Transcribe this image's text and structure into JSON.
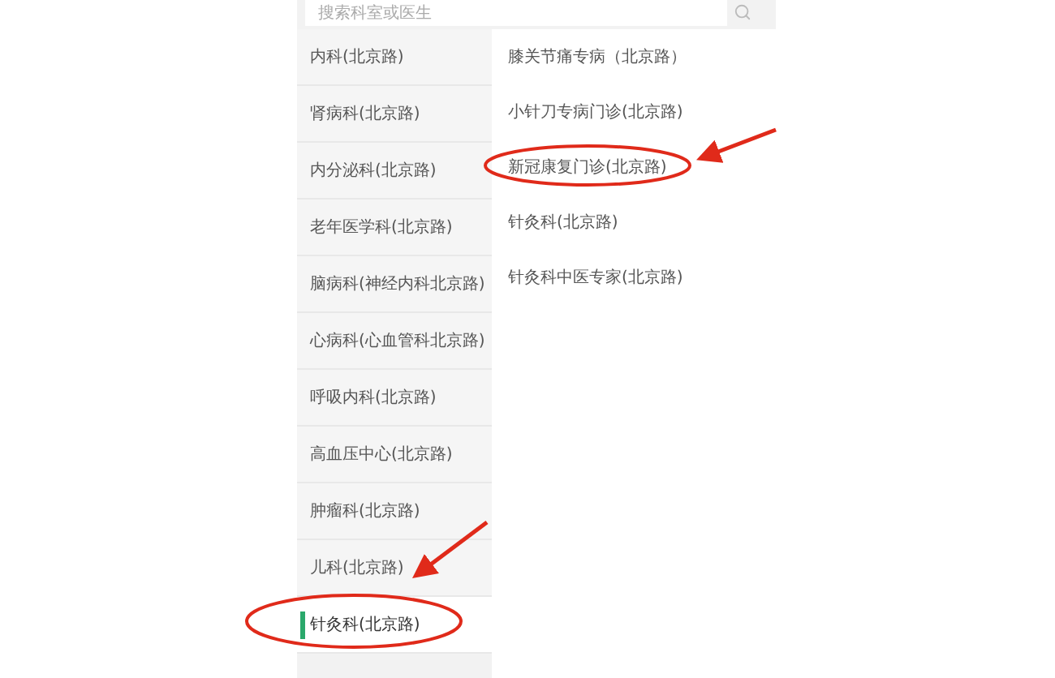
{
  "search": {
    "placeholder": "搜索科室或医生"
  },
  "departments": [
    {
      "label": "内科(北京路)",
      "selected": false
    },
    {
      "label": "肾病科(北京路)",
      "selected": false
    },
    {
      "label": "内分泌科(北京路)",
      "selected": false
    },
    {
      "label": "老年医学科(北京路)",
      "selected": false
    },
    {
      "label": "脑病科(神经内科北京路)",
      "selected": false
    },
    {
      "label": "心病科(心血管科北京路)",
      "selected": false
    },
    {
      "label": "呼吸内科(北京路)",
      "selected": false
    },
    {
      "label": "高血压中心(北京路)",
      "selected": false
    },
    {
      "label": "肿瘤科(北京路)",
      "selected": false
    },
    {
      "label": "儿科(北京路)",
      "selected": false
    },
    {
      "label": "针灸科(北京路)",
      "selected": true
    }
  ],
  "clinics": [
    {
      "label": "膝关节痛专病（北京路）"
    },
    {
      "label": "小针刀专病门诊(北京路)"
    },
    {
      "label": "新冠康复门诊(北京路)"
    },
    {
      "label": "针灸科(北京路)"
    },
    {
      "label": "针灸科中医专家(北京路)"
    }
  ]
}
